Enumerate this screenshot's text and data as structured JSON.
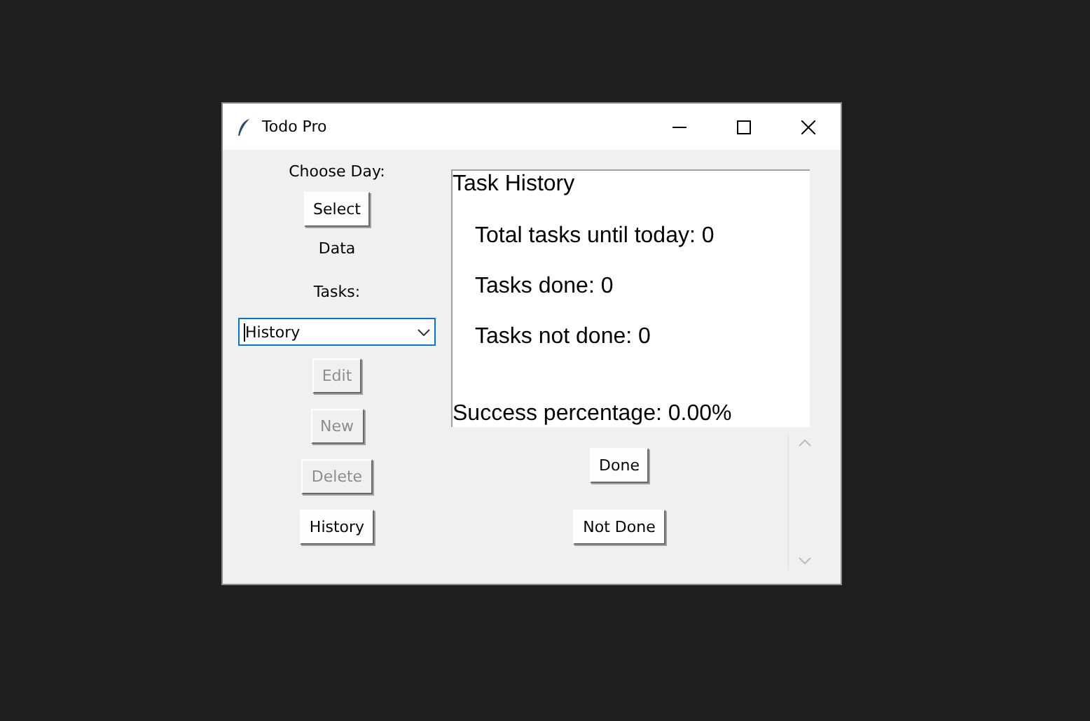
{
  "window": {
    "title": "Todo Pro"
  },
  "left": {
    "choose_label": "Choose Day:",
    "select_button": {
      "label": "Select",
      "disabled": false
    },
    "data_label": "Data",
    "tasks_label": "Tasks:",
    "tasks_combo": {
      "value": "History"
    },
    "buttons": [
      {
        "label": "Edit",
        "disabled": true
      },
      {
        "label": "New",
        "disabled": true
      },
      {
        "label": "Delete",
        "disabled": true
      },
      {
        "label": "History",
        "disabled": false
      }
    ]
  },
  "history_panel": {
    "title": "Task History",
    "lines": [
      "Total tasks until today: 0",
      "Tasks done: 0",
      "Tasks not done: 0"
    ],
    "success": "Success percentage: 0.00%"
  },
  "actions": [
    {
      "label": "Done",
      "disabled": false
    },
    {
      "label": "Not Done",
      "disabled": false
    }
  ]
}
